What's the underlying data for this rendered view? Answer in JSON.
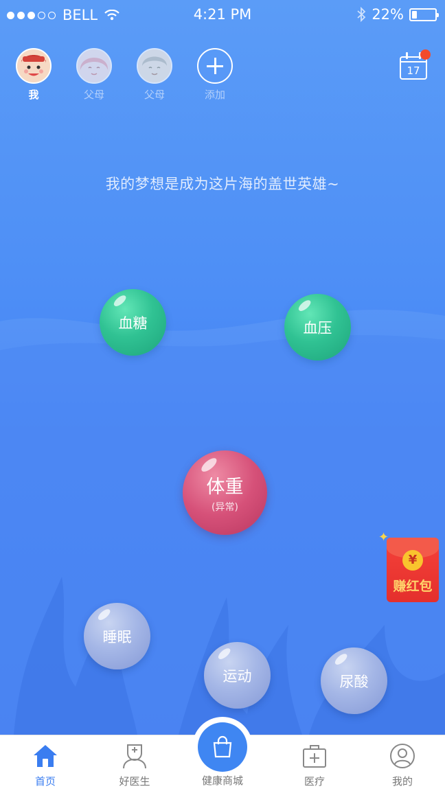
{
  "status_bar": {
    "carrier": "BELL",
    "time": "4:21 PM",
    "battery": "22%",
    "battery_level": 0.22
  },
  "members": [
    {
      "label": "我",
      "active": true
    },
    {
      "label": "父母",
      "active": false
    },
    {
      "label": "父母",
      "active": false
    },
    {
      "label": "添加",
      "active": false
    }
  ],
  "calendar": {
    "day": "17"
  },
  "motto": "我的梦想是成为这片海的盖世英雄~",
  "bubbles": {
    "blood_sugar": {
      "label": "血糖"
    },
    "blood_pressure": {
      "label": "血压"
    },
    "weight": {
      "label": "体重",
      "status": "(异常)"
    },
    "sleep": {
      "label": "睡眠"
    },
    "exercise": {
      "label": "运动"
    },
    "uric_acid": {
      "label": "尿酸"
    }
  },
  "red_packet": {
    "symbol": "¥",
    "label": "赚红包"
  },
  "tabbar": {
    "home": "首页",
    "doctor": "好医生",
    "mall": "健康商城",
    "medical": "医疗",
    "mine": "我的"
  },
  "colors": {
    "background": "#4a86f5",
    "accent": "#3a7df0",
    "green_bubble": "#30c293",
    "red_bubble": "#d65179",
    "grey_bubble": "#a4b6e6",
    "red_packet": "#e42f2c"
  }
}
